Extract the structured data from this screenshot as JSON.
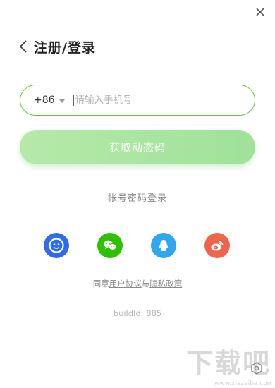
{
  "window": {
    "close_icon": "close-icon"
  },
  "header": {
    "back_icon": "chevron-left-icon",
    "title": "注册/登录"
  },
  "phone": {
    "country_code": "+86",
    "dropdown_icon": "caret-down-icon",
    "placeholder": "请输入手机号",
    "value": ""
  },
  "actions": {
    "get_code_label": "获取动态码",
    "password_login_label": "帐号密码登录"
  },
  "social_logins": [
    {
      "icon": "circle-face-icon",
      "color": "#2f6af0"
    },
    {
      "icon": "wechat-icon",
      "color": "#2dc100"
    },
    {
      "icon": "qq-icon",
      "color": "#2ea7ef"
    },
    {
      "icon": "weibo-icon",
      "color": "#f0644c"
    }
  ],
  "agreement": {
    "prefix": "同意",
    "user_agreement": "用户协议",
    "and": "与",
    "privacy_policy": "隐私政策"
  },
  "build": {
    "text": "buildId: 885"
  },
  "footer": {
    "watermark_text": "下载吧",
    "watermark_url": "www.xiazaiba.com",
    "settings_icon": "settings-icon"
  },
  "colors": {
    "accent_border": "#67c23a",
    "button_gradient_start": "#b6e9a9",
    "button_gradient_end": "#9fe29a"
  }
}
